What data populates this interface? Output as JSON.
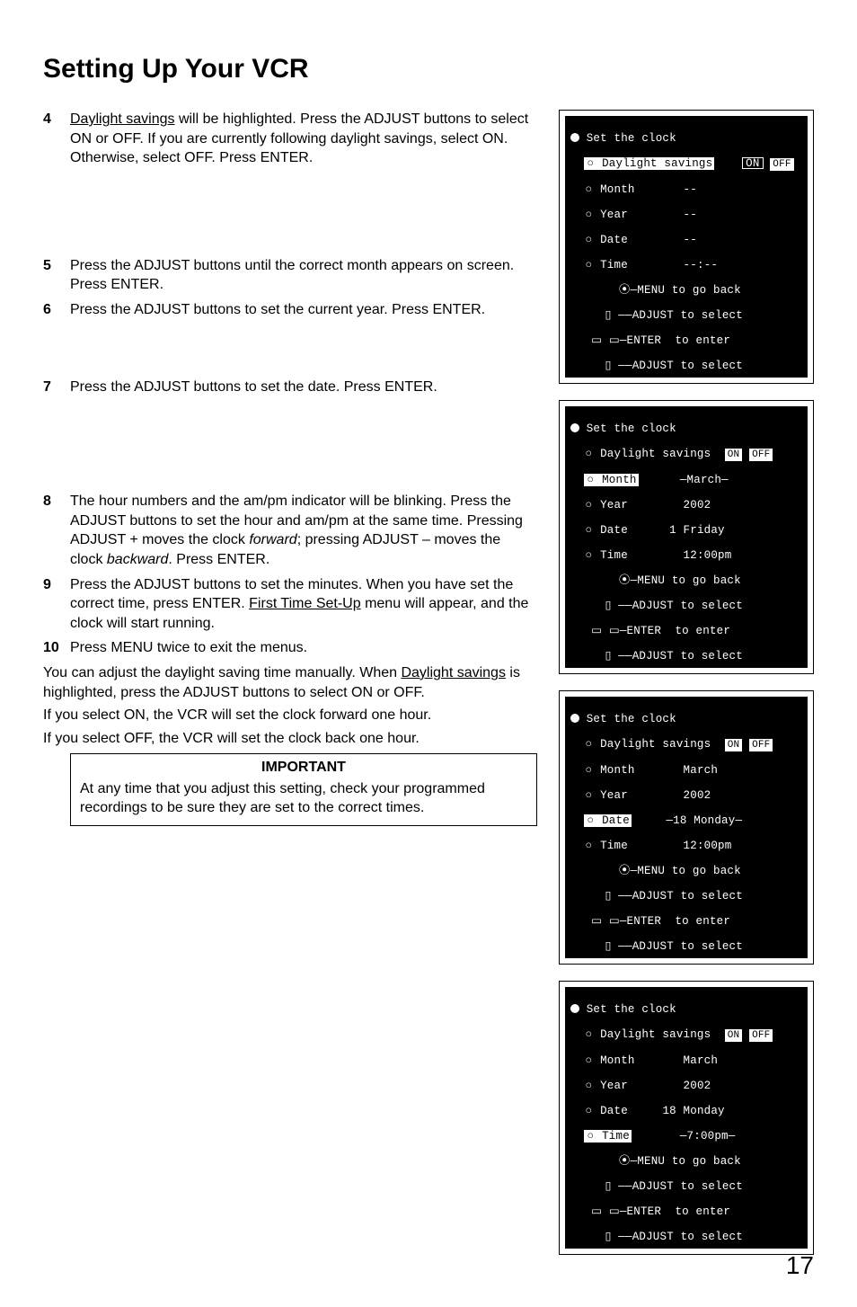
{
  "title": "Setting Up Your VCR",
  "steps": {
    "s4": {
      "num": "4",
      "text_pre": "Daylight savings",
      "text_post": " will be highlighted.  Press the ADJUST buttons to select ON or OFF.  If you are currently following daylight savings, select ON.  Otherwise, select OFF.  Press ENTER."
    },
    "s5": {
      "num": "5",
      "text": "Press the ADJUST buttons until the correct month appears on screen.  Press ENTER."
    },
    "s6": {
      "num": "6",
      "text": "Press the ADJUST buttons to set the current year.  Press ENTER."
    },
    "s7": {
      "num": "7",
      "text": "Press the ADJUST buttons to set the date.  Press ENTER."
    },
    "s8": {
      "num": "8",
      "text_a": "The hour numbers and the am/pm indicator will be blinking.  Press the ADJUST buttons to set the hour and am/pm at the same time.  Pressing ADJUST + moves the clock ",
      "fwd": "forward",
      "text_b": "; pressing ADJUST – moves the clock ",
      "bwd": "backward",
      "text_c": ".  Press ENTER."
    },
    "s9": {
      "num": "9",
      "text_a": "Press the ADJUST buttons to set the minutes.  When you have set the correct time, press ENTER.  ",
      "u": "First Time Set-Up",
      "text_b": " menu will appear, and the clock will start running."
    },
    "s10": {
      "num": "10",
      "text": "Press MENU twice to exit the menus."
    }
  },
  "para1_a": "You can adjust the daylight saving time manually.  When ",
  "para1_u": "Daylight savings",
  "para1_b": " is highlighted, press the ADJUST buttons to select ON or OFF.",
  "para2": "If you select ON, the VCR will set the clock forward one hour.",
  "para3": "If you select OFF, the VCR will set the clock back one hour.",
  "important_title": "IMPORTANT",
  "important_body": "At any time that you adjust this setting, check your programmed recordings to be sure they are set to the correct times.",
  "osd_common": {
    "header": "Set the clock",
    "daylight": "Daylight savings",
    "on": "ON",
    "off": "OFF",
    "month": "Month",
    "year": "Year",
    "date": "Date",
    "time": "Time",
    "hint1": "MENU to go back",
    "hint2": "ADJUST to select",
    "hint3": "ENTER  to enter",
    "hint4": "ADJUST to select"
  },
  "osd1": {
    "month_val": "--",
    "year_val": "--",
    "date_val": "--",
    "time_val": "--:--",
    "daylight_hl": true,
    "on_boxed": true,
    "off_filled": true
  },
  "osd2": {
    "month_val": "—March—",
    "year_val": "2002",
    "date_val": "1 Friday",
    "time_val": "12:00pm",
    "month_hl": true,
    "on_filled": true,
    "off_filled": true
  },
  "osd3": {
    "month_val": "March",
    "year_val": "2002",
    "date_val": "—18 Monday—",
    "time_val": "12:00pm",
    "date_hl": true,
    "on_filled": true,
    "off_filled": true
  },
  "osd4": {
    "month_val": "March",
    "year_val": "2002",
    "date_val": "18 Monday",
    "time_val": "—7:00pm—",
    "time_hl": true,
    "on_filled": true,
    "off_filled": true
  },
  "page_number": "17"
}
